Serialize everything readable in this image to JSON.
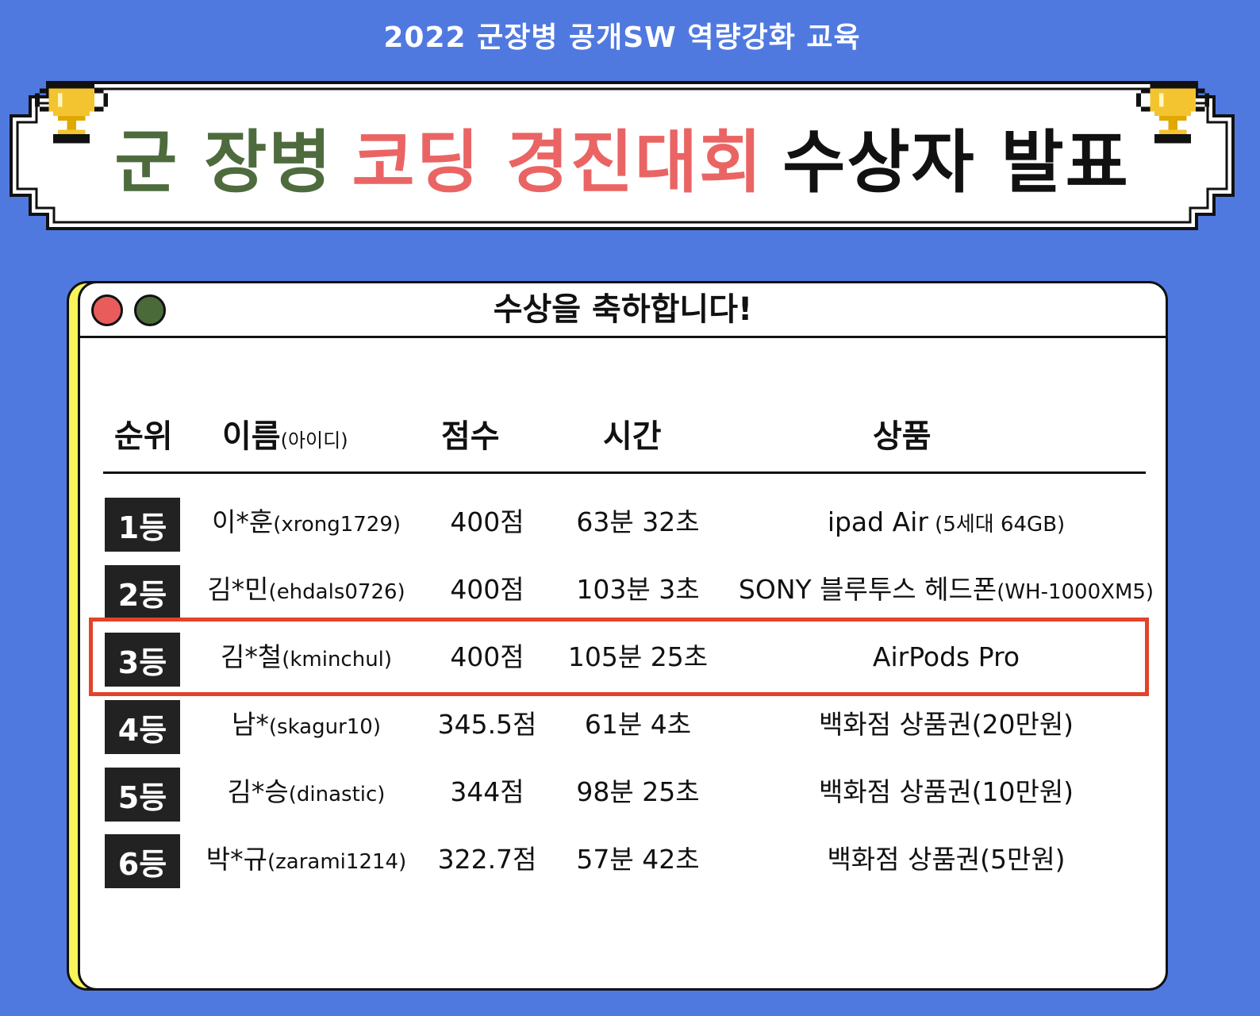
{
  "header": {
    "subtitle": "2022 군장병 공개SW 역량강화 교육",
    "title_part1": "군 장병",
    "title_part2": "코딩 경진대회",
    "title_part3": "수상자 발표"
  },
  "window": {
    "title": "수상을 축하합니다!"
  },
  "table": {
    "headers": {
      "rank": "순위",
      "name": "이름",
      "name_sub": "(아이디)",
      "score": "점수",
      "time": "시간",
      "prize": "상품"
    },
    "rows": [
      {
        "rank": "1등",
        "name": "이*훈",
        "id": "(xrong1729)",
        "score": "400점",
        "time": "63분 32초",
        "prize": "ipad Air",
        "prize_sub": " (5세대 64GB)"
      },
      {
        "rank": "2등",
        "name": "김*민",
        "id": "(ehdals0726)",
        "score": "400점",
        "time": "103분 3초",
        "prize": "SONY 블루투스 헤드폰",
        "prize_sub": "(WH-1000XM5)"
      },
      {
        "rank": "3등",
        "name": "김*철",
        "id": "(kminchul)",
        "score": "400점",
        "time": "105분 25초",
        "prize": "AirPods Pro",
        "prize_sub": ""
      },
      {
        "rank": "4등",
        "name": "남*",
        "id": "(skagur10)",
        "score": "345.5점",
        "time": "61분 4초",
        "prize": "백화점 상품권(20만원)",
        "prize_sub": ""
      },
      {
        "rank": "5등",
        "name": "김*승",
        "id": "(dinastic)",
        "score": "344점",
        "time": "98분 25초",
        "prize": "백화점 상품권(10만원)",
        "prize_sub": ""
      },
      {
        "rank": "6등",
        "name": "박*규",
        "id": "(zarami1214)",
        "score": "322.7점",
        "time": "57분 42초",
        "prize": "백화점 상품권(5만원)",
        "prize_sub": ""
      }
    ],
    "highlighted_row": 3
  },
  "colors": {
    "background": "#5079e0",
    "title_green": "#4e6b3e",
    "title_red": "#ea6464",
    "highlight": "#e2432a",
    "window_accent": "#f7f35a"
  }
}
